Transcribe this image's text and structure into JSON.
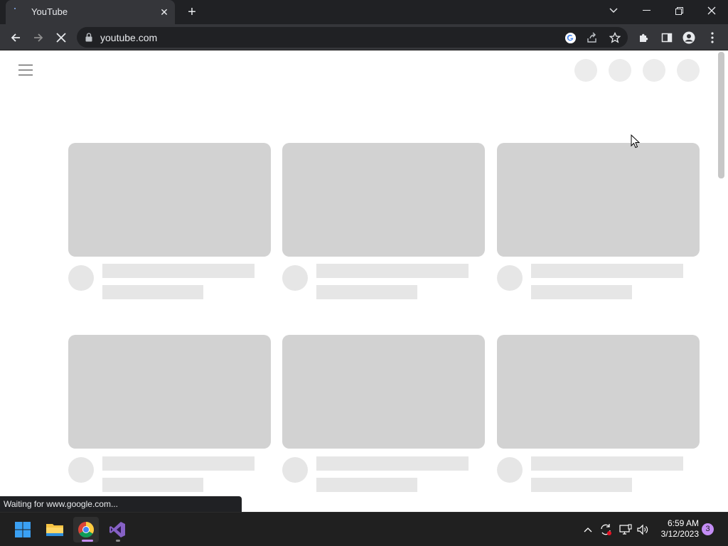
{
  "browser": {
    "tab": {
      "title": "YouTube",
      "close_icon": "close-icon"
    },
    "new_tab_icon": "plus-icon",
    "address": {
      "url": "youtube.com"
    },
    "status_text": "Waiting for www.google.com..."
  },
  "taskbar": {
    "apps": [
      "start",
      "file-explorer",
      "chrome",
      "visual-studio"
    ],
    "clock": {
      "time": "6:59 AM",
      "date": "3/12/2023"
    },
    "notification_count": "3"
  },
  "colors": {
    "skeleton_thumb": "#d2d2d2",
    "skeleton_text": "#e6e6e6",
    "accent": "#c48df5"
  }
}
